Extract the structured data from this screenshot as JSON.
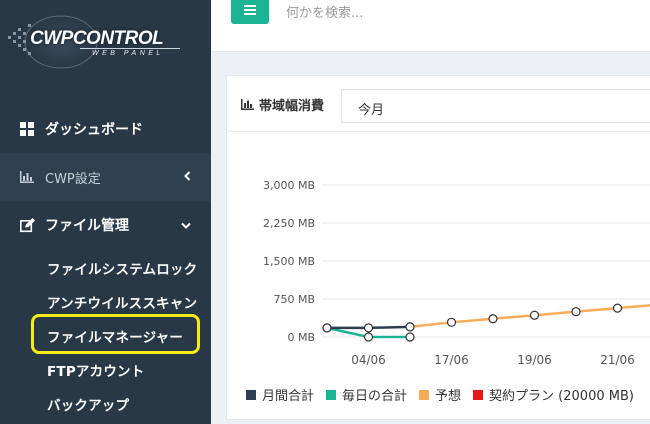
{
  "logo": {
    "text": "CWPCONTROL",
    "subtext": "WEB PANEL"
  },
  "sidebar": {
    "items": [
      {
        "label": "ダッシュボード",
        "icon": "dashboard-grid-icon"
      },
      {
        "label": "CWP設定",
        "icon": "bar-chart-icon"
      },
      {
        "label": "ファイル管理",
        "icon": "edit-icon"
      }
    ],
    "subitems": [
      {
        "label": "ファイルシステムロック"
      },
      {
        "label": "アンチウイルススキャン"
      },
      {
        "label": "ファイルマネージャー"
      },
      {
        "label": "FTPアカウント"
      },
      {
        "label": "バックアップ"
      }
    ],
    "highlight_color": "#f5eb17"
  },
  "topbar": {
    "search_placeholder": "何かを検索..."
  },
  "panel": {
    "title": "帯域幅消費",
    "period_selected": "今月"
  },
  "chart_data": {
    "type": "line",
    "yticks": [
      "3,000 MB",
      "2,250 MB",
      "1,500 MB",
      "750 MB",
      "0 MB"
    ],
    "ylim": [
      0,
      3000
    ],
    "xticks": [
      "04/06",
      "17/06",
      "19/06",
      "21/06"
    ],
    "series": [
      {
        "name": "月間合計",
        "color": "#2c3e50",
        "points": [
          [
            0,
            180
          ],
          [
            1,
            180
          ],
          [
            2,
            200
          ]
        ]
      },
      {
        "name": "毎日の合計",
        "color": "#1ab394",
        "points": [
          [
            0,
            180
          ],
          [
            1,
            0
          ],
          [
            2,
            0
          ]
        ]
      },
      {
        "name": "予想",
        "color": "#f8ac59",
        "points": [
          [
            2,
            200
          ],
          [
            3,
            290
          ],
          [
            4,
            360
          ],
          [
            5,
            430
          ],
          [
            6,
            500
          ],
          [
            7,
            570
          ],
          [
            8,
            640
          ]
        ]
      },
      {
        "name": "契約プラン (20000 MB)",
        "color": "#e81717",
        "points": []
      }
    ],
    "grid": true,
    "legend_position": "bottom"
  },
  "colors": {
    "sidebar": "#293846",
    "accent": "#1ab394",
    "forecast": "#f8ac59"
  }
}
